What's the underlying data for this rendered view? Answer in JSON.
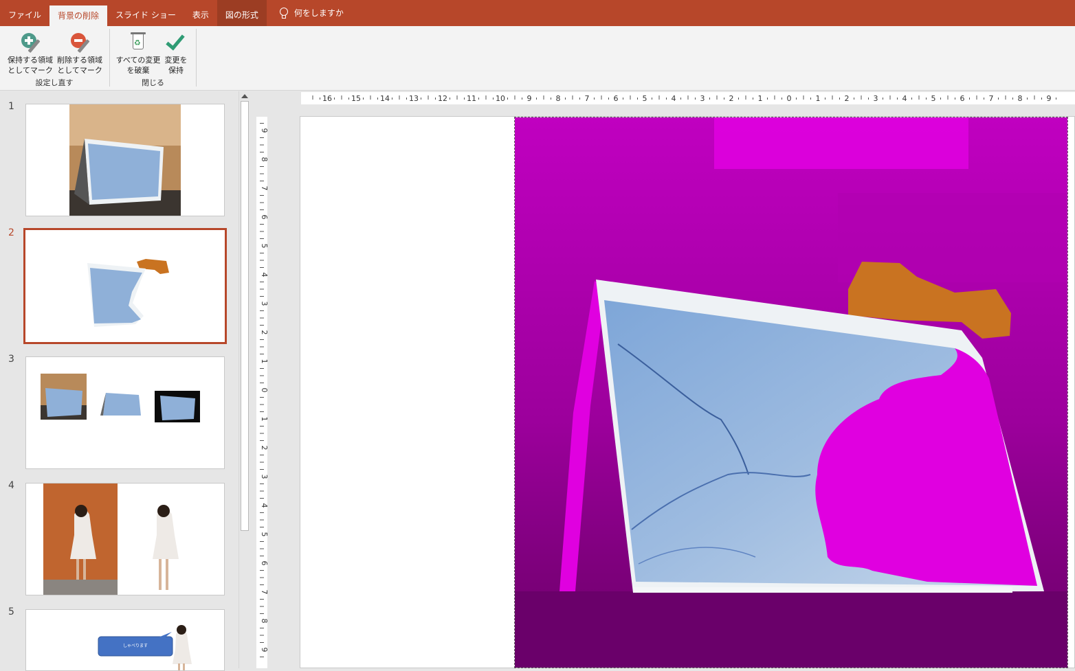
{
  "tabs": [
    {
      "label": "ファイル",
      "active": false
    },
    {
      "label": "背景の削除",
      "active": true
    },
    {
      "label": "スライド ショー",
      "active": false
    },
    {
      "label": "表示",
      "active": false
    },
    {
      "label": "図の形式",
      "active": false
    }
  ],
  "tell_me": "何をしますか",
  "ribbon": {
    "refine": {
      "mark_keep_line1": "保持する領域",
      "mark_keep_line2": "としてマーク",
      "mark_remove_line1": "削除する領域",
      "mark_remove_line2": "としてマーク",
      "group_label": "設定し直す"
    },
    "close": {
      "discard_line1": "すべての変更",
      "discard_line2": "を破棄",
      "keep_line1": "変更を",
      "keep_line2": "保持",
      "group_label": "閉じる"
    }
  },
  "slides": [
    {
      "number": "1"
    },
    {
      "number": "2",
      "selected": true
    },
    {
      "number": "3"
    },
    {
      "number": "4"
    },
    {
      "number": "5",
      "callout_text": "しゃべります"
    }
  ],
  "ruler_h": [
    "16",
    "15",
    "14",
    "13",
    "12",
    "11",
    "10",
    "9",
    "8",
    "7",
    "6",
    "5",
    "4",
    "3",
    "2",
    "1",
    "0",
    "1",
    "2",
    "3",
    "4",
    "5",
    "6",
    "7",
    "8",
    "9"
  ],
  "ruler_v": [
    "9",
    "8",
    "7",
    "6",
    "5",
    "4",
    "3",
    "2",
    "1",
    "0",
    "1",
    "2",
    "3",
    "4",
    "5",
    "6",
    "7",
    "8",
    "9"
  ],
  "colors": {
    "accent": "#b7472a",
    "removal_overlay": "#d400d4"
  }
}
